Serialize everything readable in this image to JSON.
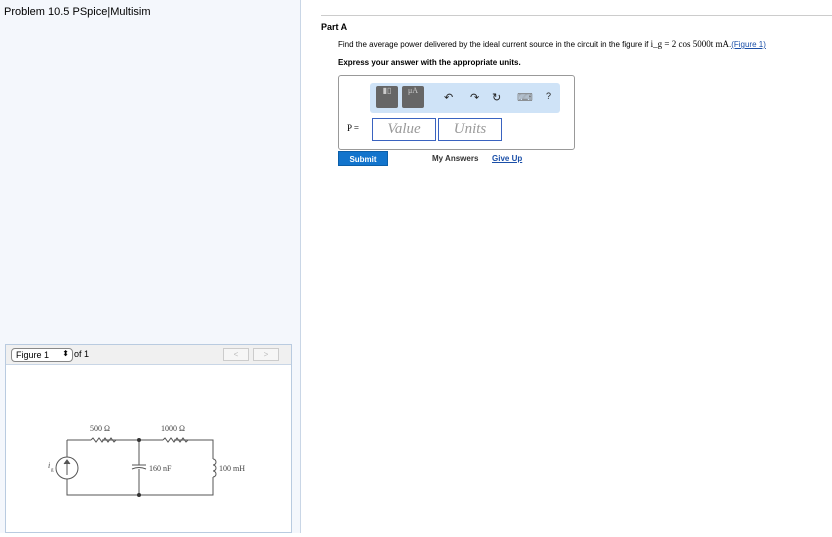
{
  "title": "Problem 10.5 PSpice|Multisim",
  "figure": {
    "selector": "Figure 1",
    "of": "of 1",
    "prev": "<",
    "next": ">",
    "labels": {
      "r1": "500 Ω",
      "r2": "1000 Ω",
      "c": "160 nF",
      "l": "100 mH",
      "src": "i",
      "src_sub": "g"
    }
  },
  "part": {
    "label": "Part A",
    "question": "Find the average power delivered by the ideal current source in the circuit in the figure if ",
    "math": "i_g = 2 cos 5000t mA",
    "period": ".",
    "figure_link": "(Figure 1)",
    "express": "Express your answer with the appropriate units.",
    "var": "P =",
    "value_placeholder": "Value",
    "units_placeholder": "Units",
    "toolbar": {
      "units": "μA",
      "undo": "↶",
      "redo": "↷",
      "reset": "↻",
      "keyboard": "⌨",
      "help": "?"
    },
    "submit": "Submit",
    "my_answers": "My Answers",
    "give_up": "Give Up"
  }
}
